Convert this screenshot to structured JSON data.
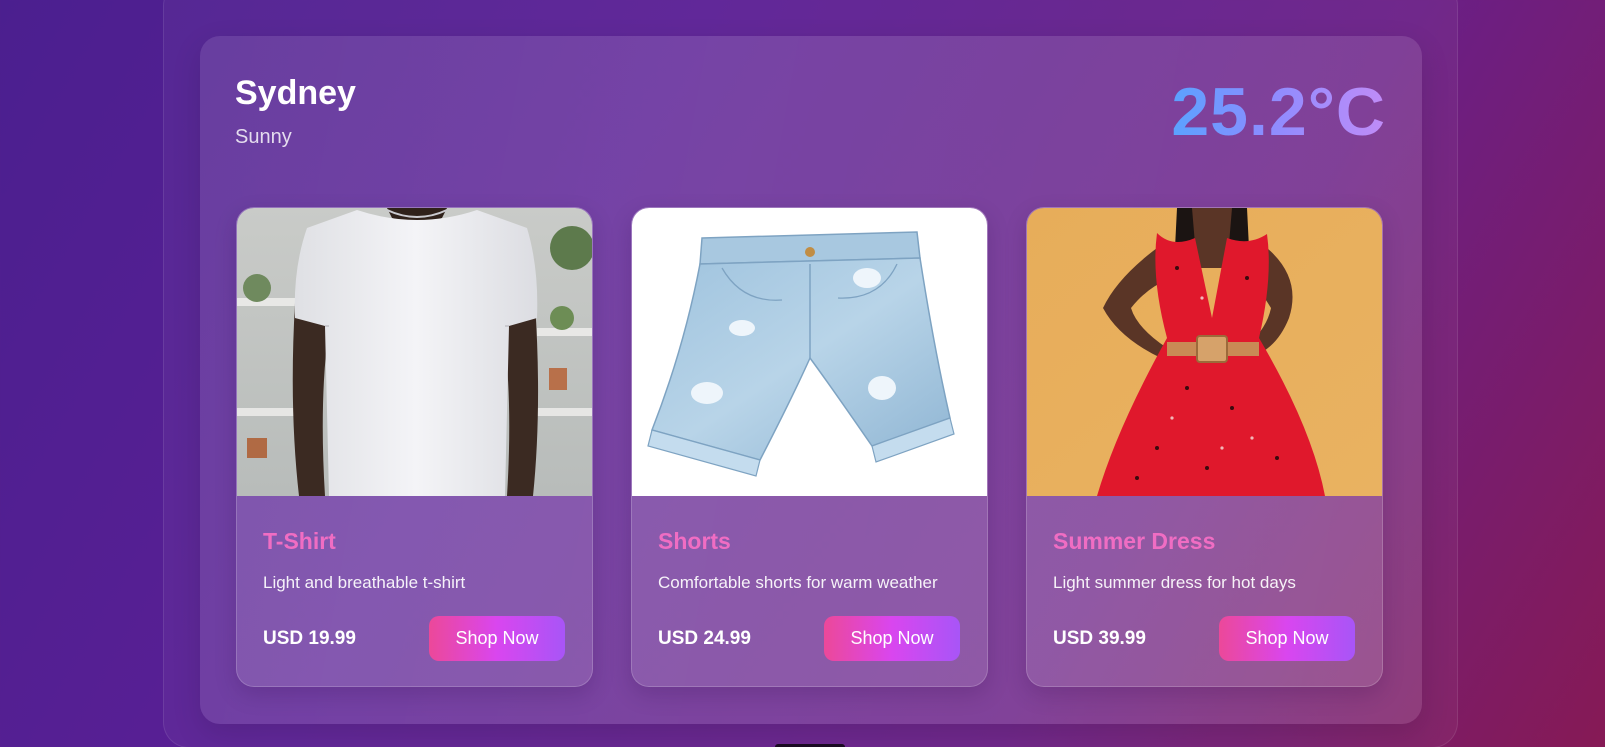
{
  "weather": {
    "city": "Sydney",
    "condition": "Sunny",
    "temperature": "25.2°C"
  },
  "products": [
    {
      "name": "T-Shirt",
      "description": "Light and breathable t-shirt",
      "price": "USD 19.99",
      "button_label": "Shop Now",
      "image_icon": "tshirt-photo"
    },
    {
      "name": "Shorts",
      "description": "Comfortable shorts for warm weather",
      "price": "USD 24.99",
      "button_label": "Shop Now",
      "image_icon": "denim-shorts-photo"
    },
    {
      "name": "Summer Dress",
      "description": "Light summer dress for hot days",
      "price": "USD 39.99",
      "button_label": "Shop Now",
      "image_icon": "red-dress-photo"
    }
  ],
  "colors": {
    "product_name": "#f06dc3",
    "button_gradient_start": "#ec4899",
    "button_gradient_end": "#a855f7",
    "temperature_gradient_start": "#5aa2ff",
    "temperature_gradient_end": "#c08cf7"
  }
}
